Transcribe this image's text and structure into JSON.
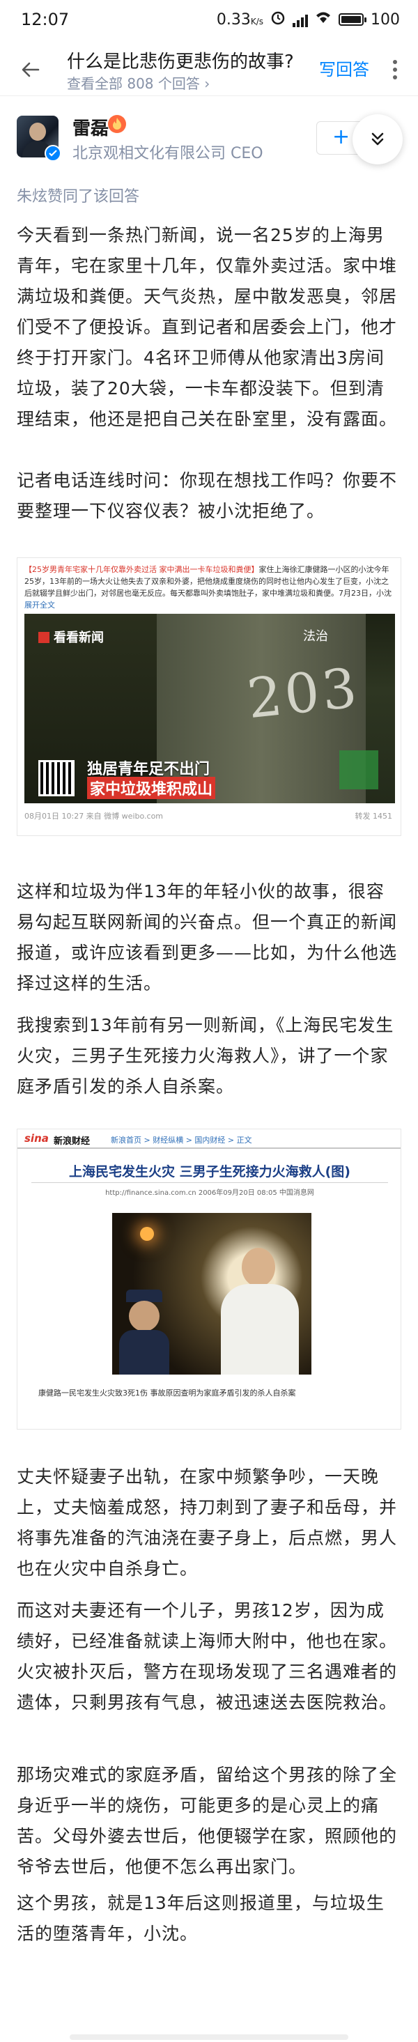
{
  "status_bar": {
    "time": "12:07",
    "speed": "0.33",
    "battery": "100",
    "battery_level": 1.0
  },
  "header": {
    "question_title": "什么是比悲伤更悲伤的故事?",
    "subtitle": "查看全部 808 个回答 ›",
    "write_answer": "写回答"
  },
  "author": {
    "name": "雷磊",
    "bio": "北京观相文化有限公司 CEO",
    "follow_label": "+"
  },
  "upvote_note": "朱炫赞同了该回答",
  "article": {
    "p1": "今天看到一条热门新闻，说一名25岁的上海男青年，宅在家里十几年，仅靠外卖过活。家中堆满垃圾和粪便。天气炎热，屋中散发恶臭，邻居们受不了便投诉。直到记者和居委会上门，他才终于打开家门。4名环卫师傅从他家清出3房间垃圾，装了20大袋，一卡车都没装下。但到清理结束，他还是把自己关在卧室里，没有露面。",
    "p2": "记者电话连线时问：你现在想找工作吗？你要不要整理一下仪容仪表？被小沈拒绝了。",
    "p3": "这样和垃圾为伴13年的年轻小伙的故事，很容易勾起互联网新闻的兴奋点。但一个真正的新闻报道，或许应该看到更多——比如，为什么他选择过这样的生活。",
    "p4": "我搜索到13年前有另一则新闻，《上海民宅发生火灾，三男子生死接力火海救人》，讲了一个家庭矛盾引发的杀人自杀案。",
    "p5": "丈夫怀疑妻子出轨，在家中频繁争吵，一天晚上，丈夫恼羞成怒，持刀刺到了妻子和岳母，并将事先准备的汽油浇在妻子身上，后点燃，男人也在火灾中自杀身亡。",
    "p6": "而这对夫妻还有一个儿子，男孩12岁，因为成绩好，已经准备就读上海师大附中，他也在家。火灾被扑灭后，警方在现场发现了三名遇难者的遗体，只剩男孩有气息，被迅速送去医院救治。",
    "p7": "那场灾难式的家庭矛盾，留给这个男孩的除了全身近乎一半的烧伤，可能更多的是心灵上的痛苦。父母外婆去世后，他便辍学在家，照顾他的爷爷去世后，他便不怎么再出家门。",
    "p8": "这个男孩，就是13年后这则报道里，与垃圾生活的堕落青年，小沈。"
  },
  "image1": {
    "weibo_text_tag": "【25岁男青年宅家十几年仅靠外卖过活 家中满出一卡车垃圾和粪便】",
    "weibo_text_body": "家住上海徐汇康健路一小区的小沈今年25岁，13年前的一场大火让他失去了双亲和外婆，把他烧成重度烧伤的同时也让他内心发生了巨变，小沈之后就辍学且鲜少出门，对邻居也毫无反应。每天都靠叫外卖填饱肚子，家中堆满垃圾和粪便。7月23日，小沈",
    "weibo_expand": "展开全文",
    "video_logo": "看看新闻",
    "video_source": "法治",
    "door_number": "203",
    "caption_line1": "独居青年足不出门",
    "caption_line2": "家中垃圾堆积成山",
    "meta": "08月01日 10:27 来自 微博 weibo.com",
    "stats": "转发 1451"
  },
  "image2": {
    "sina_logo": "sina",
    "sina_brand": "新浪财经",
    "breadcrumb": "新浪首页 > 财经纵横 > 国内财经 > 正文",
    "title": "上海民宅发生火灾 三男子生死接力火海救人(图)",
    "source_line": "http://finance.sina.com.cn 2006年09月20日 08:05 中国消息网",
    "caption": "康健路一民宅发生火灾致3死1伤 事故原因查明为家庭矛盾引发的杀人自杀案"
  },
  "colors": {
    "accent": "#0084ff",
    "secondary_text": "#8590a6",
    "body_text": "#262626"
  }
}
